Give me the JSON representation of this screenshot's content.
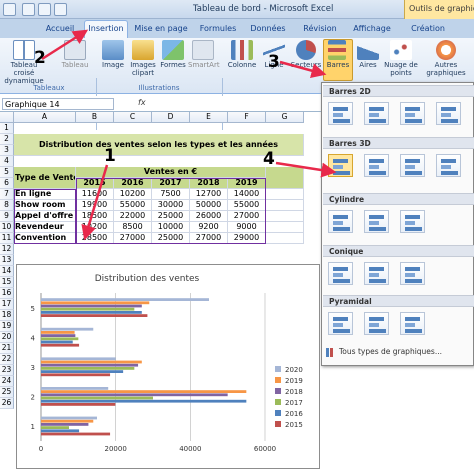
{
  "window": {
    "title": "Tableau de bord - Microsoft Excel",
    "contextual_tab": "Outils de graphique"
  },
  "tabs": [
    "Accueil",
    "Insertion",
    "Mise en page",
    "Formules",
    "Données",
    "Révision",
    "Affichage",
    "Création"
  ],
  "ribbon": {
    "tableaux": {
      "label": "Tableaux",
      "buttons": [
        "Tableau croisé dynamique",
        "Tableau"
      ]
    },
    "illustrations": {
      "label": "Illustrations",
      "buttons": [
        "Image",
        "Images clipart",
        "Formes",
        "SmartArt"
      ]
    },
    "charts": {
      "buttons": [
        "Colonne",
        "Ligne",
        "Secteurs",
        "Barres",
        "Aires",
        "Nuage de points",
        "Autres graphiques"
      ]
    }
  },
  "formula_bar": {
    "name_box": "Graphique 14",
    "fx": "fx"
  },
  "sheet": {
    "columns": [
      "A",
      "B",
      "C",
      "D",
      "E",
      "F",
      "G"
    ],
    "rows": [
      "1",
      "2",
      "3",
      "4",
      "5",
      "6",
      "7",
      "8",
      "9",
      "10",
      "11",
      "12",
      "13",
      "14",
      "15",
      "16",
      "17",
      "18",
      "19",
      "20",
      "21",
      "22",
      "23",
      "24",
      "25",
      "26"
    ],
    "title": "Distribution des ventes selon les types et les années",
    "ventes_header": "Ventes en €",
    "type_header": "Type de Ventes",
    "years": [
      "2015",
      "2016",
      "2017",
      "2018",
      "2019"
    ],
    "data": [
      {
        "type": "En ligne",
        "values": [
          "11600",
          "10200",
          "7500",
          "12700",
          "14000"
        ]
      },
      {
        "type": "Show room",
        "values": [
          "19900",
          "55000",
          "30000",
          "50000",
          "55000"
        ]
      },
      {
        "type": "Appel d'offre",
        "values": [
          "18500",
          "22000",
          "25000",
          "26000",
          "27000"
        ]
      },
      {
        "type": "Revendeur",
        "values": [
          "10200",
          "8500",
          "10000",
          "9200",
          "9000"
        ]
      },
      {
        "type": "Convention",
        "values": [
          "28500",
          "27000",
          "25000",
          "27000",
          "29000"
        ]
      }
    ]
  },
  "chart_data": {
    "type": "bar",
    "title": "Distribution des ventes",
    "categories": [
      "1",
      "2",
      "3",
      "4",
      "5"
    ],
    "series": [
      {
        "name": "2015",
        "color": "#c0504d",
        "values": [
          18500,
          19900,
          18500,
          10200,
          28500
        ]
      },
      {
        "name": "2016",
        "color": "#4f81bd",
        "values": [
          10200,
          55000,
          22000,
          8500,
          27000
        ]
      },
      {
        "name": "2017",
        "color": "#9bbb59",
        "values": [
          7500,
          30000,
          25000,
          10000,
          25000
        ]
      },
      {
        "name": "2018",
        "color": "#8064a2",
        "values": [
          12700,
          50000,
          26000,
          9200,
          27000
        ]
      },
      {
        "name": "2019",
        "color": "#f79646",
        "values": [
          14000,
          55000,
          27000,
          9000,
          29000
        ]
      },
      {
        "name": "2020",
        "color": "#a5b6d6",
        "values": [
          15000,
          18000,
          20000,
          14000,
          45000
        ]
      }
    ],
    "xlim": [
      0,
      60000
    ],
    "x_ticks": [
      "0",
      "20000",
      "40000",
      "60000"
    ],
    "grid": true,
    "legend": "right"
  },
  "gallery": {
    "sections": [
      "Barres 2D",
      "Barres 3D",
      "Cylindre",
      "Conique",
      "Pyramidal"
    ],
    "all_types": "Tous types de graphiques..."
  },
  "annotations": [
    "1",
    "2",
    "3",
    "4"
  ],
  "colors": {
    "accent": "#15428b",
    "title_fill": "#d7e4a9",
    "table_header_fill": "#c6d98e",
    "arrow": "#e8294b"
  }
}
